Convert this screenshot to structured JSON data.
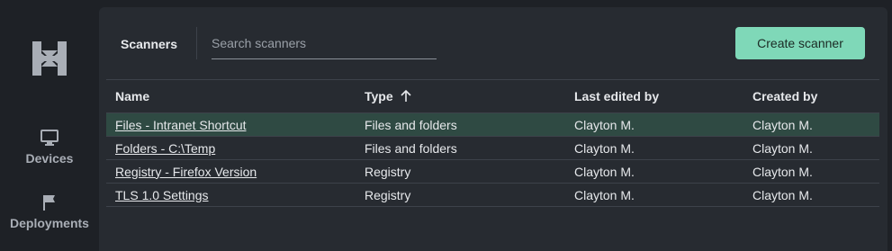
{
  "sidebar": {
    "items": [
      {
        "label": "Devices",
        "icon": "monitor-icon"
      },
      {
        "label": "Deployments",
        "icon": "flag-icon"
      }
    ]
  },
  "toolbar": {
    "title": "Scanners",
    "search_placeholder": "Search scanners",
    "search_value": "",
    "create_label": "Create scanner"
  },
  "table": {
    "columns": [
      "Name",
      "Type",
      "Last edited by",
      "Created by"
    ],
    "sorted_column": "Type",
    "sort_direction": "ascending",
    "rows": [
      {
        "name": "Files - Intranet Shortcut",
        "type": "Files and folders",
        "last_edited_by": "Clayton M.",
        "created_by": "Clayton M.",
        "selected": true
      },
      {
        "name": "Folders - C:\\Temp",
        "type": "Files and folders",
        "last_edited_by": "Clayton M.",
        "created_by": "Clayton M.",
        "selected": false
      },
      {
        "name": "Registry - Firefox Version",
        "type": "Registry",
        "last_edited_by": "Clayton M.",
        "created_by": "Clayton M.",
        "selected": false
      },
      {
        "name": "TLS 1.0 Settings",
        "type": "Registry",
        "last_edited_by": "Clayton M.",
        "created_by": "Clayton M.",
        "selected": false
      }
    ]
  },
  "colors": {
    "accent": "#7fd8b8",
    "selected_row": "#2f4a43",
    "panel": "#272b31",
    "background": "#1e2126"
  }
}
